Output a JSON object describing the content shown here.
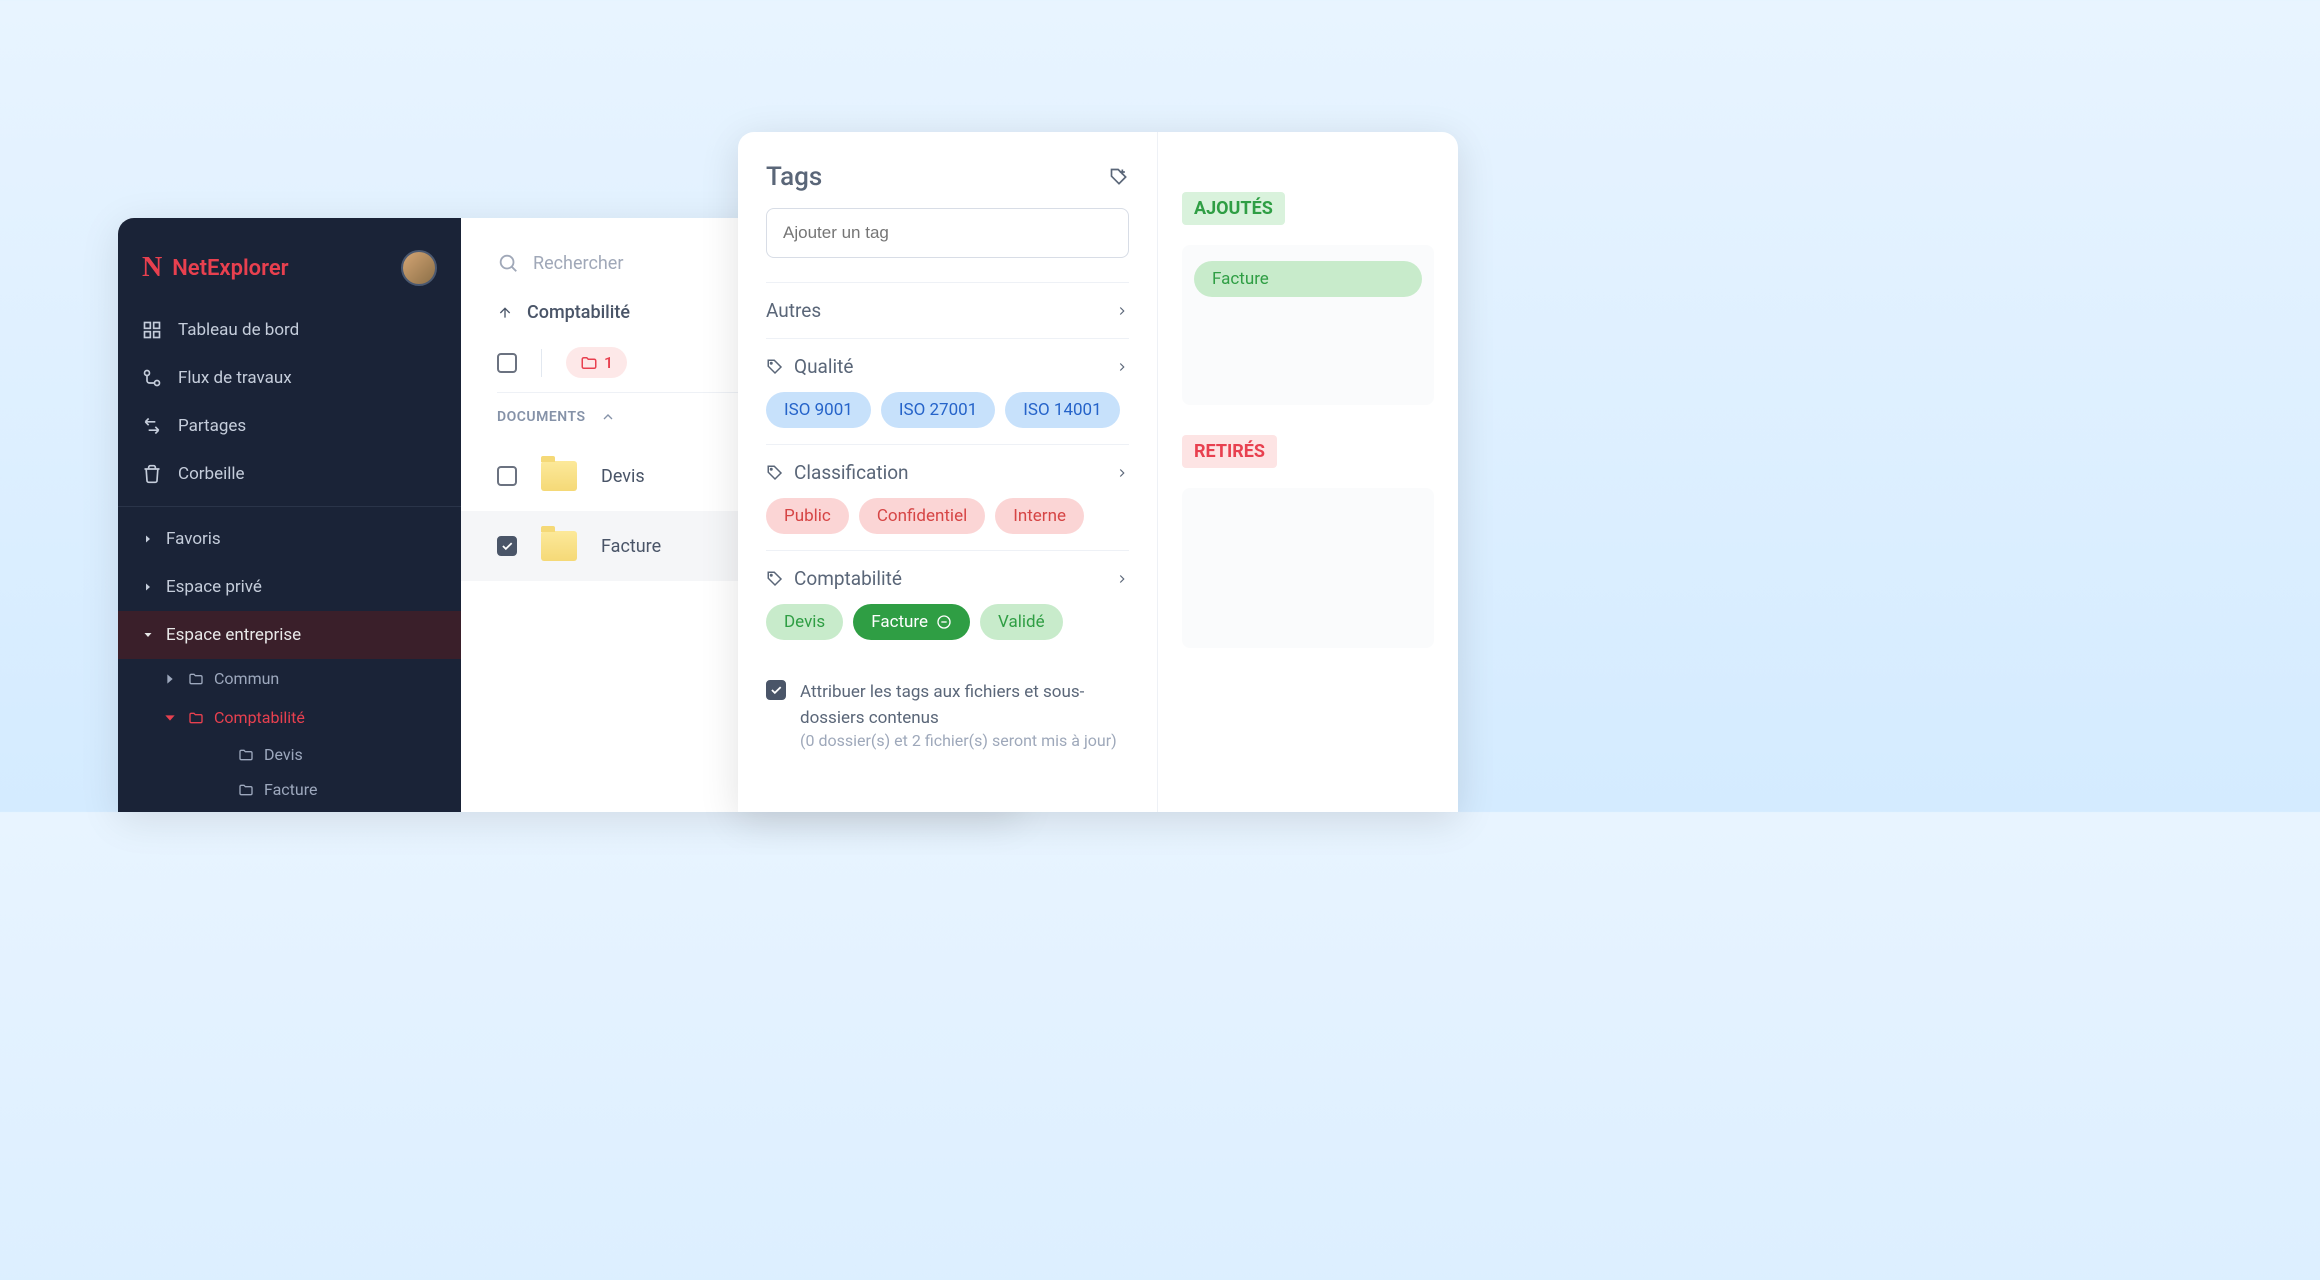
{
  "app": {
    "name": "NetExplorer"
  },
  "sidebar": {
    "nav": [
      {
        "label": "Tableau de bord"
      },
      {
        "label": "Flux de travaux"
      },
      {
        "label": "Partages"
      },
      {
        "label": "Corbeille"
      }
    ],
    "sections": {
      "favoris": "Favoris",
      "prive": "Espace privé",
      "entreprise": "Espace entreprise"
    },
    "tree": {
      "commun": "Commun",
      "comptabilite": "Comptabilité",
      "devis": "Devis",
      "facture": "Facture"
    }
  },
  "main": {
    "search_placeholder": "Rechercher",
    "breadcrumb": "Comptabilité",
    "folder_count": "1",
    "section_label": "DOCUMENTS",
    "files": {
      "devis": "Devis",
      "facture": "Facture"
    }
  },
  "tags": {
    "title": "Tags",
    "input_placeholder": "Ajouter un tag",
    "categories": {
      "autres": "Autres",
      "qualite": "Qualité",
      "classification": "Classification",
      "comptabilite": "Comptabilité"
    },
    "qualite_tags": {
      "iso9001": "ISO 9001",
      "iso27001": "ISO 27001",
      "iso14001": "ISO 14001"
    },
    "classification_tags": {
      "public": "Public",
      "confidentiel": "Confidentiel",
      "interne": "Interne"
    },
    "comptabilite_tags": {
      "devis": "Devis",
      "facture": "Facture",
      "valide": "Validé"
    },
    "attribute_check": "Attribuer les tags aux fichiers et sous-dossiers contenus",
    "attribute_sub": "(0 dossier(s) et 2 fichier(s) seront mis à jour)",
    "added_label": "AJOUTÉS",
    "removed_label": "RETIRÉS",
    "added_tag": "Facture"
  }
}
